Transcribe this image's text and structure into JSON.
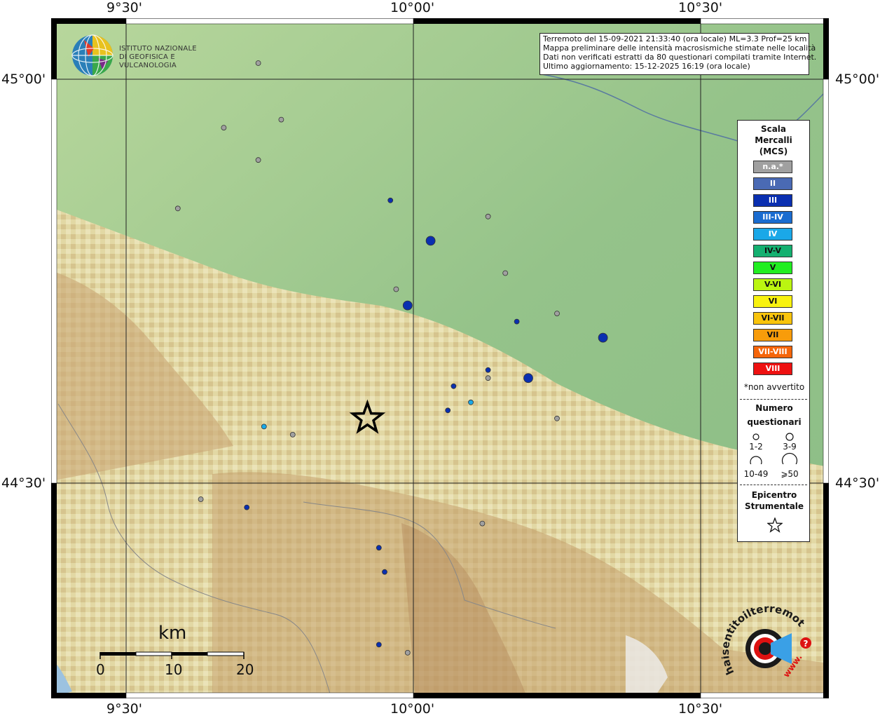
{
  "coords": {
    "top": [
      "9°30'",
      "10°00'",
      "10°30'"
    ],
    "bottom": [
      "9°30'",
      "10°00'",
      "10°30'"
    ],
    "left": [
      "45°00'",
      "44°30'"
    ],
    "right": [
      "45°00'",
      "44°30'"
    ]
  },
  "logo": {
    "line1": "ISTITUTO NAZIONALE",
    "line2": "DI GEOFISICA E VULCANOLOGIA"
  },
  "info": {
    "line1": "Terremoto del 15-09-2021 21:33:40 (ora locale) ML=3.3 Prof=25 km",
    "line2": "Mappa preliminare delle intensità macrosismiche stimate nelle località",
    "line3": "Dati non verificati estratti da 80 questionari compilati tramite Internet.",
    "line4": "Ultimo aggiornamento: 15-12-2025 16:19 (ora locale)"
  },
  "legend": {
    "title1": "Scala",
    "title2": "Mercalli",
    "title3": "(MCS)",
    "scale": [
      {
        "label": "n.a.*",
        "color": "#a0a0a0",
        "text": "#ffffff"
      },
      {
        "label": "II",
        "color": "#4a6ab4",
        "text": "#ffffff"
      },
      {
        "label": "III",
        "color": "#0a2fb0",
        "text": "#ffffff"
      },
      {
        "label": "III-IV",
        "color": "#1a6cd0",
        "text": "#ffffff"
      },
      {
        "label": "IV",
        "color": "#1aa8e8",
        "text": "#ffffff"
      },
      {
        "label": "IV-V",
        "color": "#14b070",
        "text": "#111111"
      },
      {
        "label": "V",
        "color": "#22ee22",
        "text": "#111111"
      },
      {
        "label": "V-VI",
        "color": "#bbf511",
        "text": "#111111"
      },
      {
        "label": "VI",
        "color": "#f8f20e",
        "text": "#111111"
      },
      {
        "label": "VI-VII",
        "color": "#f9c40c",
        "text": "#111111"
      },
      {
        "label": "VII",
        "color": "#f89c0a",
        "text": "#111111"
      },
      {
        "label": "VII-VIII",
        "color": "#f5650a",
        "text": "#ffffff"
      },
      {
        "label": "VIII",
        "color": "#ee1111",
        "text": "#ffffff"
      }
    ],
    "note": "*non avvertito",
    "count_title1": "Numero",
    "count_title2": "questionari",
    "sizes": [
      "1-2",
      "3-9",
      "10-49",
      "⩾50"
    ],
    "epi_title1": "Epicentro",
    "epi_title2": "Strumentale"
  },
  "scalebar": {
    "unit": "km",
    "labels": [
      "0",
      "10",
      "20"
    ]
  },
  "hsit_logo": {
    "text": "haisentitoilterremoto.it",
    "url": "www.",
    "q": "?"
  },
  "colors": {
    "na": "#a0a0a0",
    "II": "#4a6ab4",
    "III": "#0a2fb0",
    "IIIIV": "#1a6cd0",
    "IV": "#1aa8e8"
  },
  "points": [
    {
      "lon": 9.96,
      "lat": 44.85,
      "intensity": "III",
      "n": "3-9"
    },
    {
      "lon": 10.03,
      "lat": 44.8,
      "intensity": "III",
      "n": "10-49"
    },
    {
      "lon": 9.99,
      "lat": 44.72,
      "intensity": "III",
      "n": "10-49"
    },
    {
      "lon": 10.18,
      "lat": 44.7,
      "intensity": "III",
      "n": "3-9"
    },
    {
      "lon": 10.33,
      "lat": 44.68,
      "intensity": "III",
      "n": "10-49"
    },
    {
      "lon": 10.13,
      "lat": 44.64,
      "intensity": "III",
      "n": "3-9"
    },
    {
      "lon": 10.2,
      "lat": 44.63,
      "intensity": "III",
      "n": "10-49"
    },
    {
      "lon": 10.07,
      "lat": 44.62,
      "intensity": "III",
      "n": "3-9"
    },
    {
      "lon": 10.06,
      "lat": 44.59,
      "intensity": "III",
      "n": "3-9"
    },
    {
      "lon": 10.1,
      "lat": 44.6,
      "intensity": "IV",
      "n": "3-9"
    },
    {
      "lon": 9.74,
      "lat": 44.57,
      "intensity": "IV",
      "n": "3-9"
    },
    {
      "lon": 9.94,
      "lat": 44.42,
      "intensity": "III",
      "n": "3-9"
    },
    {
      "lon": 9.95,
      "lat": 44.39,
      "intensity": "III",
      "n": "3-9"
    },
    {
      "lon": 9.71,
      "lat": 44.47,
      "intensity": "III",
      "n": "3-9"
    },
    {
      "lon": 9.94,
      "lat": 44.3,
      "intensity": "III",
      "n": "3-9"
    },
    {
      "lon": 9.73,
      "lat": 45.02,
      "intensity": "na",
      "n": "3-9"
    },
    {
      "lon": 9.77,
      "lat": 44.95,
      "intensity": "na",
      "n": "3-9"
    },
    {
      "lon": 9.67,
      "lat": 44.94,
      "intensity": "na",
      "n": "3-9"
    },
    {
      "lon": 9.73,
      "lat": 44.9,
      "intensity": "na",
      "n": "3-9"
    },
    {
      "lon": 9.59,
      "lat": 44.84,
      "intensity": "na",
      "n": "3-9"
    },
    {
      "lon": 10.13,
      "lat": 44.83,
      "intensity": "na",
      "n": "3-9"
    },
    {
      "lon": 10.16,
      "lat": 44.76,
      "intensity": "na",
      "n": "3-9"
    },
    {
      "lon": 9.97,
      "lat": 44.74,
      "intensity": "na",
      "n": "3-9"
    },
    {
      "lon": 10.25,
      "lat": 44.71,
      "intensity": "na",
      "n": "3-9"
    },
    {
      "lon": 10.13,
      "lat": 44.63,
      "intensity": "na",
      "n": "3-9"
    },
    {
      "lon": 10.25,
      "lat": 44.58,
      "intensity": "na",
      "n": "3-9"
    },
    {
      "lon": 9.79,
      "lat": 44.56,
      "intensity": "na",
      "n": "3-9"
    },
    {
      "lon": 10.12,
      "lat": 44.45,
      "intensity": "na",
      "n": "3-9"
    },
    {
      "lon": 9.63,
      "lat": 44.48,
      "intensity": "na",
      "n": "3-9"
    },
    {
      "lon": 9.99,
      "lat": 44.29,
      "intensity": "na",
      "n": "3-9"
    }
  ],
  "epicenter": {
    "lon": 9.92,
    "lat": 44.58
  }
}
